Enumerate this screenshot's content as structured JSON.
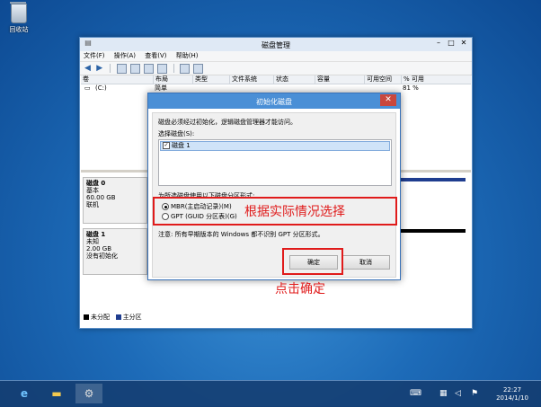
{
  "desktop": {
    "recycle_bin_label": "回收站"
  },
  "window": {
    "title": "磁盘管理",
    "menu": [
      "文件(F)",
      "操作(A)",
      "查看(V)",
      "帮助(H)"
    ],
    "columns": [
      "卷",
      "布局",
      "类型",
      "文件系统",
      "状态",
      "容量",
      "可用空间",
      "% 可用"
    ],
    "volume_row": {
      "name": "(C:)",
      "layout": "简单",
      "pct": "81 %"
    },
    "disks": [
      {
        "name": "磁盘 0",
        "type": "基本",
        "size": "60.00 GB",
        "status": "联机"
      },
      {
        "name": "磁盘 1",
        "type": "未知",
        "size": "2.00 GB",
        "status": "没有初始化"
      }
    ],
    "legend": [
      {
        "label": "未分配",
        "color": "#000000"
      },
      {
        "label": "主分区",
        "color": "#1f3d8f"
      }
    ]
  },
  "dialog": {
    "title": "初始化磁盘",
    "intro": "磁盘必须经过初始化，逻辑磁盘管理器才能访问。",
    "select_label": "选择磁盘(S):",
    "disk_item": "磁盘 1",
    "partition_label": "为所选磁盘使用以下磁盘分区形式:",
    "option_mbr": "MBR(主启动记录)(M)",
    "option_gpt": "GPT (GUID 分区表)(G)",
    "note": "注意: 所有早期版本的 Windows 都不识别 GPT 分区形式。",
    "ok": "确定",
    "cancel": "取消"
  },
  "annotations": {
    "choose": "根据实际情况选择",
    "click_ok": "点击确定"
  },
  "taskbar": {
    "time": "22:27",
    "date": "2014/1/10"
  },
  "colors": {
    "accent": "#4a8fd6",
    "annotation": "#e01b1b",
    "close": "#c9473d"
  }
}
